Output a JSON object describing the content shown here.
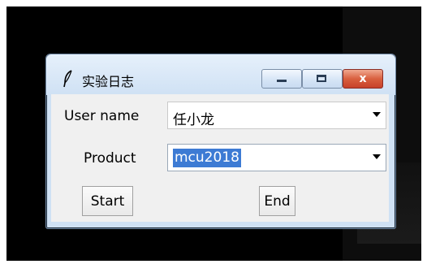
{
  "window": {
    "title": "实验日志",
    "controls": {
      "close_glyph": "x"
    }
  },
  "form": {
    "user_label": "User name",
    "user_value": "任小龙",
    "product_label": "Product",
    "product_value": "mcu2018"
  },
  "buttons": {
    "start_label": "Start",
    "end_label": "End"
  },
  "icons": {
    "app": "feather-icon",
    "dropdown": "chevron-down-icon"
  },
  "colors": {
    "selection": "#3d7bd4",
    "close_button": "#d9603f",
    "title_bar": "#cfe1f4"
  }
}
